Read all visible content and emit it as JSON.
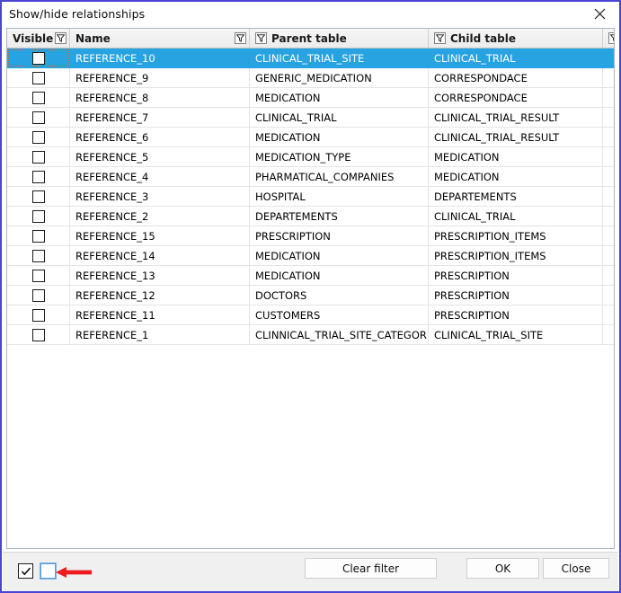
{
  "window": {
    "title": "Show/hide relationships",
    "close_icon": "close-icon",
    "border_color": "#4a45d6"
  },
  "grid": {
    "filter_icon": "filter-funnel-icon",
    "selection_color": "#28a3e1",
    "columns": [
      {
        "key": "visible",
        "label": "Visible",
        "filter": true,
        "filter_side": "right"
      },
      {
        "key": "name",
        "label": "Name",
        "filter": true,
        "filter_side": "right"
      },
      {
        "key": "parent",
        "label": "Parent table",
        "filter": true,
        "filter_side": "left"
      },
      {
        "key": "child",
        "label": "Child table",
        "filter": true,
        "filter_side": "left"
      },
      {
        "key": "trailing",
        "label": "",
        "filter": true,
        "filter_side": "right"
      }
    ],
    "rows": [
      {
        "visible": false,
        "name": "REFERENCE_10",
        "parent": "CLINICAL_TRIAL_SITE",
        "child": "CLINICAL_TRIAL",
        "selected": true
      },
      {
        "visible": false,
        "name": "REFERENCE_9",
        "parent": "GENERIC_MEDICATION",
        "child": "CORRESPONDACE",
        "selected": false
      },
      {
        "visible": false,
        "name": "REFERENCE_8",
        "parent": "MEDICATION",
        "child": "CORRESPONDACE",
        "selected": false
      },
      {
        "visible": false,
        "name": "REFERENCE_7",
        "parent": "CLINICAL_TRIAL",
        "child": "CLINICAL_TRIAL_RESULT",
        "selected": false
      },
      {
        "visible": false,
        "name": "REFERENCE_6",
        "parent": "MEDICATION",
        "child": "CLINICAL_TRIAL_RESULT",
        "selected": false
      },
      {
        "visible": false,
        "name": "REFERENCE_5",
        "parent": "MEDICATION_TYPE",
        "child": "MEDICATION",
        "selected": false
      },
      {
        "visible": false,
        "name": "REFERENCE_4",
        "parent": "PHARMATICAL_COMPANIES",
        "child": "MEDICATION",
        "selected": false
      },
      {
        "visible": false,
        "name": "REFERENCE_3",
        "parent": "HOSPITAL",
        "child": "DEPARTEMENTS",
        "selected": false
      },
      {
        "visible": false,
        "name": "REFERENCE_2",
        "parent": "DEPARTEMENTS",
        "child": "CLINICAL_TRIAL",
        "selected": false
      },
      {
        "visible": false,
        "name": "REFERENCE_15",
        "parent": "PRESCRIPTION",
        "child": "PRESCRIPTION_ITEMS",
        "selected": false
      },
      {
        "visible": false,
        "name": "REFERENCE_14",
        "parent": "MEDICATION",
        "child": "PRESCRIPTION_ITEMS",
        "selected": false
      },
      {
        "visible": false,
        "name": "REFERENCE_13",
        "parent": "MEDICATION",
        "child": "PRESCRIPTION",
        "selected": false
      },
      {
        "visible": false,
        "name": "REFERENCE_12",
        "parent": "DOCTORS",
        "child": "PRESCRIPTION",
        "selected": false
      },
      {
        "visible": false,
        "name": "REFERENCE_11",
        "parent": "CUSTOMERS",
        "child": "PRESCRIPTION",
        "selected": false
      },
      {
        "visible": false,
        "name": "REFERENCE_1",
        "parent": "CLINNICAL_TRIAL_SITE_CATEGORIE",
        "child": "CLINICAL_TRIAL_SITE",
        "selected": false
      }
    ]
  },
  "footer": {
    "check_all": {
      "name": "check-all-checkbox",
      "checked": true
    },
    "uncheck_all": {
      "name": "uncheck-all-checkbox",
      "checked": false,
      "focused": true
    },
    "annotation_arrow": {
      "name": "red-arrow-annotation",
      "color": "#ee1c22",
      "direction": "left"
    },
    "buttons": {
      "clear_filter": "Clear filter",
      "ok": "OK",
      "close": "Close"
    }
  }
}
